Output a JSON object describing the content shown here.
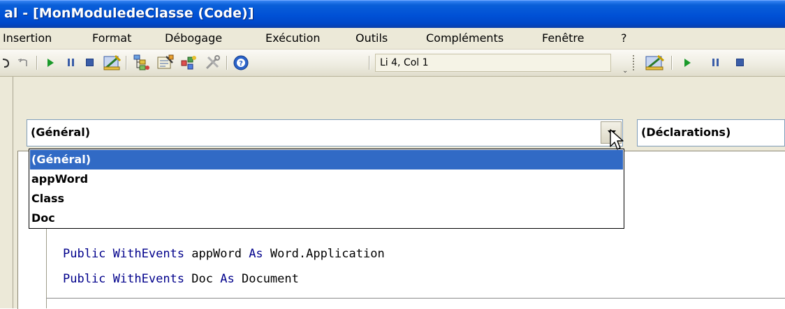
{
  "window": {
    "title": "al - [MonModuledeClasse (Code)]"
  },
  "menu": {
    "items": [
      "Insertion",
      "Format",
      "Débogage",
      "Exécution",
      "Outils",
      "Compléments",
      "Fenêtre",
      "?"
    ]
  },
  "toolbar": {
    "position_label": "Li 4, Col 1",
    "chevron": "⌄"
  },
  "editor": {
    "object_combo": {
      "value": "(Général)"
    },
    "procedure_combo": {
      "value": "(Déclarations)"
    },
    "dropdown_options": [
      "(Général)",
      "appWord",
      "Class",
      "Doc"
    ],
    "selected_option": "(Général)",
    "code": [
      {
        "kw1": "Public",
        "kw2": "WithEvents",
        "name": "appWord",
        "kw3": "As",
        "type": "Word.Application"
      },
      {
        "kw1": "Public",
        "kw2": "WithEvents",
        "name": "Doc",
        "kw3": "As",
        "type": "Document"
      }
    ]
  },
  "colors": {
    "titlebar": "#0051d6",
    "selection": "#316ac5",
    "keyword": "#00008b",
    "menubar": "#ece9d8"
  },
  "icons": [
    "undo-icon",
    "redo-icon",
    "run-icon",
    "break-icon",
    "reset-icon",
    "design-mode-icon",
    "project-explorer-icon",
    "properties-icon",
    "object-browser-icon",
    "toolbox-icon",
    "help-icon"
  ]
}
